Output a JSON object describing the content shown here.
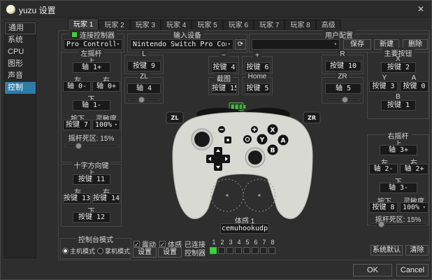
{
  "window": {
    "title": "yuzu 设置",
    "ok": "OK",
    "cancel": "Cancel"
  },
  "icons": {
    "close": "✕",
    "dropdown": "▾",
    "refresh": "⟳",
    "check": "✓"
  },
  "colors": {
    "accent_green": "#3bd23b",
    "selection_blue": "#2d7ca6",
    "battery_green": "#4caf50",
    "controller_body": "#d9d9d4"
  },
  "sidebar": {
    "items": [
      "通用",
      "系统",
      "CPU",
      "图形",
      "声音",
      "控制"
    ]
  },
  "tabs": [
    "玩家 1",
    "玩家 2",
    "玩家 3",
    "玩家 4",
    "玩家 5",
    "玩家 6",
    "玩家 7",
    "玩家 8",
    "高级"
  ],
  "toolbar": {
    "connect_label": "连接控制器",
    "controller_type": "Pro Controller",
    "input_device_label": "输入设备",
    "input_device_value": "Nintendo Switch Pro Control",
    "profile_label": "用户配置",
    "profile_value": "",
    "save": "保存",
    "new": "新建",
    "delete": "删除"
  },
  "labels": {
    "up": "上",
    "down": "下",
    "left": "左",
    "right": "右",
    "press": "按下",
    "sensitivity": "灵敏度"
  },
  "left_stick": {
    "title": "左摇杆",
    "up": "轴 1+",
    "left": "轴 0-",
    "right": "轴 0+",
    "down": "轴 1-",
    "press": "按键 7",
    "sensitivity": "100%",
    "deadzone": "摇杆死区: 15%"
  },
  "dpad": {
    "title": "十字方向键",
    "up": "按键 11",
    "left": "按键 13",
    "right": "按键 14",
    "down": "按键 12"
  },
  "triggers": {
    "l_title": "L",
    "l": "按键 9",
    "zl_title": "ZL",
    "zl": "轴 4",
    "r_title": "R",
    "r": "按键 10",
    "zr_title": "ZR",
    "zr": "轴 5"
  },
  "system_buttons": {
    "minus_title": "−",
    "minus": "按键 4",
    "plus_title": "+",
    "plus": "按键 6",
    "capture_title": "截图",
    "capture": "按键 15",
    "home_title": "Home",
    "home": "按键 5"
  },
  "face_buttons": {
    "title": "主要按钮",
    "x_title": "X",
    "x": "按键 2",
    "y_title": "Y",
    "y": "按键 3",
    "a_title": "A",
    "a": "按键 0",
    "b_title": "B",
    "b": "按键 1"
  },
  "right_stick": {
    "title": "右摇杆",
    "up": "轴 3+",
    "left": "轴 2-",
    "right": "轴 2+",
    "down": "轴 3-",
    "press": "按键 8",
    "sensitivity": "100%",
    "deadzone": "摇杆死区: 15%"
  },
  "motion_binding": {
    "label": "体感 1",
    "value": "cemuhookudp"
  },
  "controller": {
    "zl": "ZL",
    "zr": "ZR",
    "x": "X",
    "y": "Y",
    "a": "A",
    "b": "B"
  },
  "bottom": {
    "console_mode": {
      "title": "控制台模式",
      "docked": "主机模式",
      "handheld": "掌机模式"
    },
    "vibration": {
      "label": "震动",
      "settings": "设置"
    },
    "motion": {
      "label": "体感",
      "settings": "设置"
    },
    "connected": {
      "label": "已连接",
      "controllers_label": "控制器",
      "numbers": [
        "1",
        "2",
        "3",
        "4",
        "5",
        "6",
        "7",
        "8"
      ]
    },
    "defaults": "系统默认",
    "clear": "清除"
  }
}
